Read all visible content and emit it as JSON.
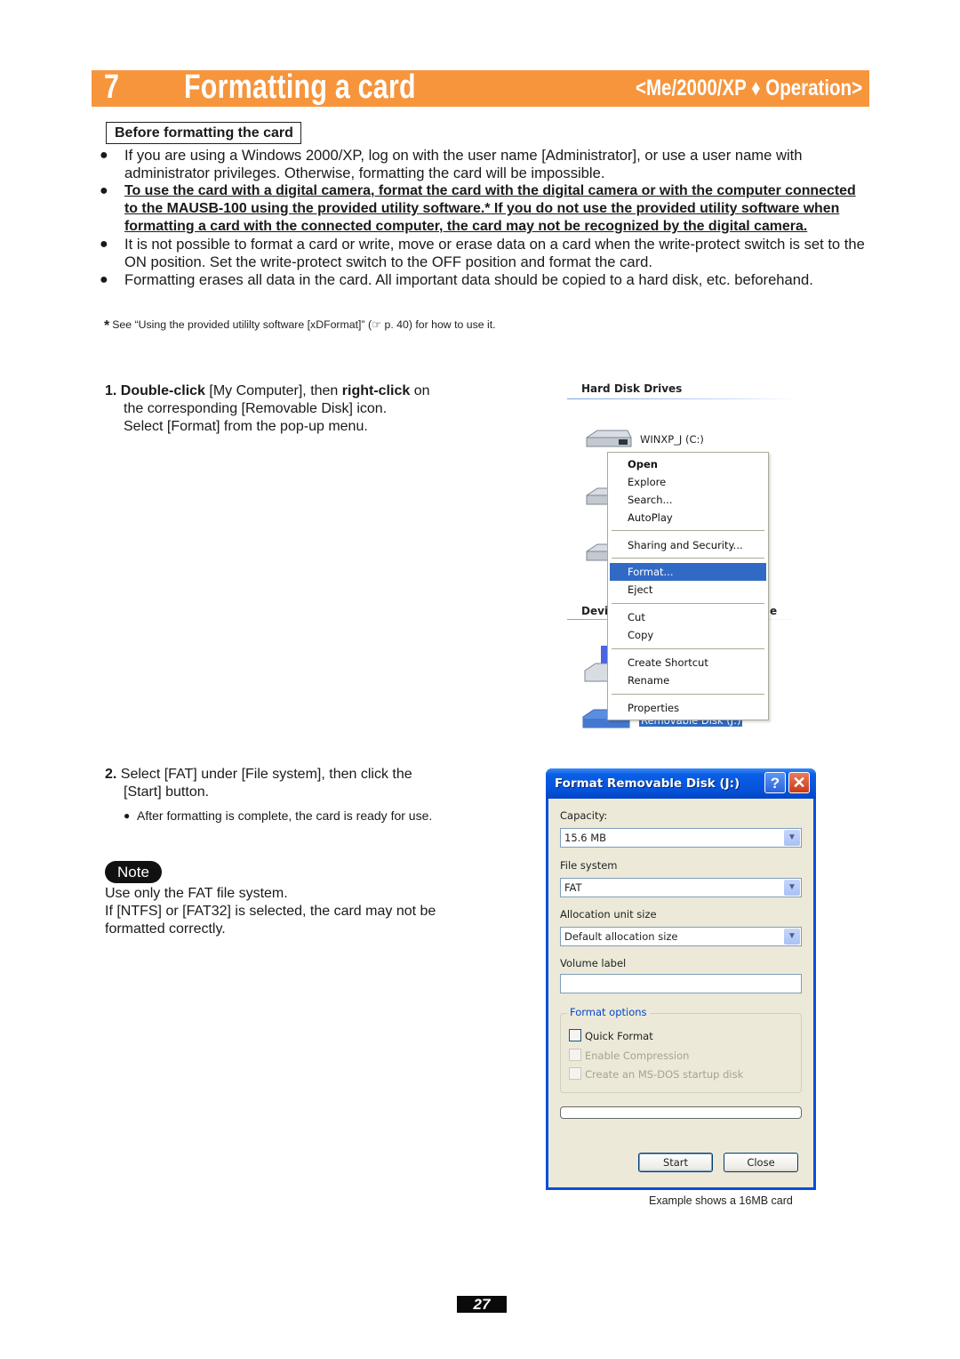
{
  "header": {
    "chapter_number": "7",
    "title": "Formatting a card",
    "tag": "<Me/2000/XP ♦ Operation>",
    "accent_color": "#f7953d"
  },
  "section": {
    "heading": "Before formatting the card",
    "bullets": [
      {
        "text": "If you are using a Windows 2000/XP, log on with the user name [Administrator], or use a user name with administrator privileges. Otherwise, formatting the card will be impossible.",
        "emphasis": false
      },
      {
        "text": "To use the card with a digital camera, format the card with the digital camera or with the computer connected to the MAUSB-100 using the provided utility software.* If you do not use the provided utility software when formatting a card with the connected computer, the card may not be recognized by the digital camera.",
        "emphasis": true
      },
      {
        "text": "It is not possible to format a card or write, move or erase data on a card when the write-protect switch is set to the ON position. Set the write-protect switch to the OFF position and format the card.",
        "emphasis": false
      },
      {
        "text": "Formatting erases all data in the card. All important data should be copied to a hard disk, etc. beforehand.",
        "emphasis": false
      }
    ],
    "footnote_marker": "*",
    "footnote": "See “Using the provided utililty software [xDFormat]” (☞ p. 40) for how to use it."
  },
  "step1": {
    "number": "1.",
    "bold1": "Double-click",
    "text1": " [My Computer], then ",
    "bold2": "right-click",
    "text2": " on",
    "line2": "the corresponding [Removable Disk] icon.",
    "line3": "Select [Format] from the pop-up menu."
  },
  "explorer": {
    "hard_disk_heading": "Hard Disk Drives",
    "devices_heading_start": "Devi",
    "devices_heading_end": "e",
    "drive_c_label": "WINXP_J (C:)",
    "removable_label": "Removable Disk (J:)",
    "context_menu": {
      "items": [
        {
          "label": "Open",
          "bold": true
        },
        {
          "label": "Explore"
        },
        {
          "label": "Search..."
        },
        {
          "label": "AutoPlay"
        },
        {
          "label": "Sharing and Security..."
        },
        {
          "label": "Format...",
          "selected": true
        },
        {
          "label": "Eject"
        },
        {
          "label": "Cut"
        },
        {
          "label": "Copy"
        },
        {
          "label": "Create Shortcut"
        },
        {
          "label": "Rename"
        },
        {
          "label": "Properties"
        }
      ]
    }
  },
  "step2": {
    "number": "2.",
    "line1": "Select [FAT] under [File system], then click the",
    "line2": "[Start] button.",
    "sub_bullet": "After formatting is complete, the card is ready for use."
  },
  "note": {
    "badge": "Note",
    "line1": "Use only the FAT file system.",
    "line2": "If [NTFS] or [FAT32] is selected, the card may not be formatted correctly."
  },
  "dialog": {
    "title": "Format Removable Disk (J:)",
    "help_label": "?",
    "close_label": "✕",
    "capacity_label": "Capacity:",
    "capacity_value": "15.6 MB",
    "filesystem_label": "File system",
    "filesystem_value": "FAT",
    "allocation_label": "Allocation unit size",
    "allocation_value": "Default allocation size",
    "volume_label": "Volume label",
    "volume_value": "",
    "options_label": "Format options",
    "options": [
      {
        "label": "Quick Format",
        "checked": false,
        "enabled": true
      },
      {
        "label": "Enable Compression",
        "checked": false,
        "enabled": false
      },
      {
        "label": "Create an MS-DOS startup disk",
        "checked": false,
        "enabled": false
      }
    ],
    "progress": 0,
    "start_button": "Start",
    "close_button": "Close"
  },
  "caption": "Example shows a 16MB card",
  "page_number": "27"
}
